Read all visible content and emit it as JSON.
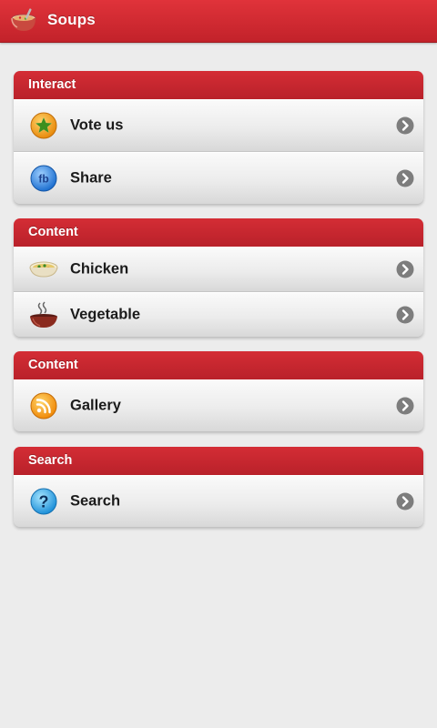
{
  "app": {
    "title": "Soups"
  },
  "groups": [
    {
      "header": "Interact",
      "items": [
        {
          "label": "Vote us",
          "icon": "star-icon"
        },
        {
          "label": "Share",
          "icon": "facebook-icon"
        }
      ]
    },
    {
      "header": "Content",
      "items": [
        {
          "label": "Chicken",
          "icon": "soup-bowl-icon"
        },
        {
          "label": "Vegetable",
          "icon": "steaming-pot-icon"
        }
      ]
    },
    {
      "header": "Content",
      "items": [
        {
          "label": "Gallery",
          "icon": "rss-icon"
        }
      ]
    },
    {
      "header": "Search",
      "items": [
        {
          "label": "Search",
          "icon": "help-icon"
        }
      ]
    }
  ],
  "colors": {
    "accent": "#c8262e",
    "background": "#ececec"
  }
}
